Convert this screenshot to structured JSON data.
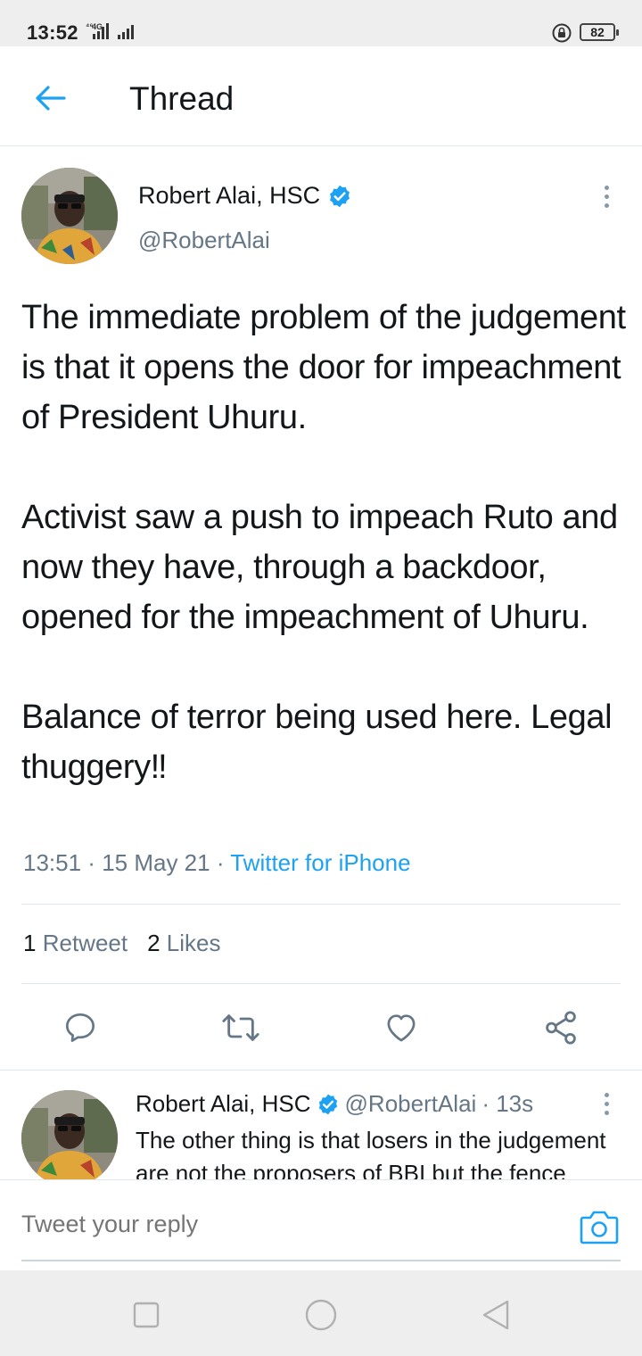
{
  "status_bar": {
    "time": "13:52",
    "network": "4G",
    "battery": "82",
    "icons": [
      "signal-icon",
      "lock-rotation-icon",
      "battery-icon"
    ]
  },
  "header": {
    "title": "Thread",
    "back_icon": "arrow-left-icon"
  },
  "tweet": {
    "author_name": "Robert Alai, HSC",
    "verified": true,
    "handle": "@RobertAlai",
    "text": "The immediate problem of the judgement is that it opens the door for impeachment of President Uhuru.\n\nActivist saw a push to impeach Ruto and now they have, through a backdoor, opened for the impeachment of Uhuru.\n\nBalance of terror being used here. Legal thuggery‼",
    "time": "13:51",
    "date": "15 May 21",
    "source": "Twitter for iPhone",
    "separator": " · ",
    "retweet_count": "1",
    "retweet_label": "Retweet",
    "like_count": "2",
    "like_label": "Likes"
  },
  "actions": {
    "reply_icon": "reply-icon",
    "retweet_icon": "retweet-icon",
    "like_icon": "heart-icon",
    "share_icon": "share-icon"
  },
  "reply": {
    "author_name": "Robert Alai, HSC",
    "verified": true,
    "handle": "@RobertAlai",
    "age": "· 13s",
    "text": "The other thing is that losers in the judgement are not the proposers of BBI but the fence"
  },
  "composer": {
    "placeholder": "Tweet your reply",
    "camera_icon": "camera-icon"
  },
  "navbar": {
    "icons": [
      "square-icon",
      "circle-icon",
      "triangle-back-icon"
    ]
  },
  "colors": {
    "accent": "#1da1f2",
    "text": "#14171a",
    "secondary": "#657786",
    "border": "#e1e8ed",
    "system_bar": "#eeeeef"
  }
}
